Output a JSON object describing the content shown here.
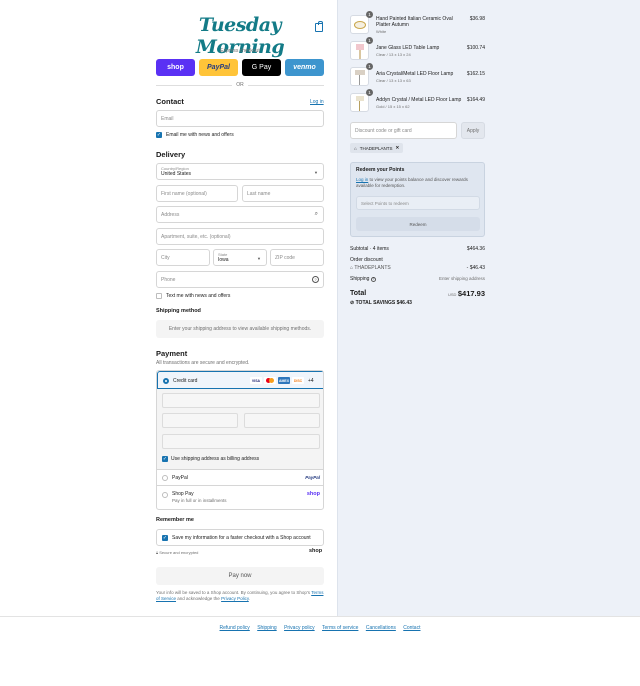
{
  "brand": {
    "logo_text": "Tuesday Morning"
  },
  "express": {
    "label": "Express checkout",
    "shop": "shop",
    "paypal": "PayPal",
    "gpay": "G Pay",
    "venmo": "venmo",
    "or": "OR"
  },
  "contact": {
    "title": "Contact",
    "login": "Log in",
    "email_placeholder": "Email",
    "email_news": "Email me with news and offers"
  },
  "delivery": {
    "title": "Delivery",
    "country_label": "Country/Region",
    "country_value": "United States",
    "first_name": "First name (optional)",
    "last_name": "Last name",
    "address": "Address",
    "apartment": "Apartment, suite, etc. (optional)",
    "city": "City",
    "state_label": "State",
    "state_value": "Iowa",
    "zip": "ZIP code",
    "phone": "Phone",
    "text_news": "Text me with news and offers"
  },
  "shipping": {
    "title": "Shipping method",
    "message": "Enter your shipping address to view available shipping methods."
  },
  "payment": {
    "title": "Payment",
    "subtitle": "All transactions are secure and encrypted.",
    "credit_card": "Credit card",
    "brands": [
      "VISA",
      "MC",
      "AMEX",
      "DISC"
    ],
    "more": "+4",
    "billing": "Use shipping address as billing address",
    "paypal": "PayPal",
    "paypal_logo": "PayPal",
    "shoppay": "Shop Pay",
    "shoppay_sub": "Pay in full or in installments",
    "shop_logo": "shop"
  },
  "remember": {
    "title": "Remember me",
    "save": "Save my information for a faster checkout with a Shop account",
    "secure": "Secure and encrypted",
    "shop_logo": "shop"
  },
  "pay_now": "Pay now",
  "legal": {
    "line1": "Your info will be saved to a Shop account. By continuing, you agree to Shop's",
    "terms": "Terms of Service",
    "and": "and acknowledge the",
    "privacy": "Privacy Policy",
    "end": "."
  },
  "footer": [
    "Refund policy",
    "Shipping",
    "Privacy policy",
    "Terms of service",
    "Cancellations",
    "Contact"
  ],
  "cart": {
    "items": [
      {
        "qty": "1",
        "name": "Hand Painted Italian Ceramic Oval Platter Autumn",
        "variant": "White",
        "price": "$36.98"
      },
      {
        "qty": "1",
        "name": "Jane Glass LED Table Lamp",
        "variant": "Clear / 13 x 13 x 24",
        "price": "$100.74"
      },
      {
        "qty": "1",
        "name": "Aria Crystal/Metal LED Floor Lamp",
        "variant": "Clear / 13 x 13 x 63",
        "price": "$162.15"
      },
      {
        "qty": "1",
        "name": "Addyn Crystal / Metal LED Floor Lamp",
        "variant": "Gold / 15 x 15 x 62",
        "price": "$164.49"
      }
    ],
    "discount_placeholder": "Discount code or gift card",
    "apply": "Apply",
    "tag": "THADEPLANTS",
    "redeem_title": "Redeem your Points",
    "redeem_login": "Log in",
    "redeem_text": "to view your points balance and discover rewards available for redemption.",
    "redeem_select": "Select Points to redeem",
    "redeem_button": "Redeem",
    "subtotal_label": "Subtotal · 4 items",
    "subtotal": "$464.36",
    "order_discount": "Order discount",
    "discount_code": "THADEPLANTS",
    "discount_amount": "- $46.43",
    "shipping_label": "Shipping",
    "shipping_value": "Enter shipping address",
    "total_label": "Total",
    "currency": "USD",
    "total": "$417.93",
    "savings_label": "TOTAL SAVINGS",
    "savings": "$46.43"
  }
}
